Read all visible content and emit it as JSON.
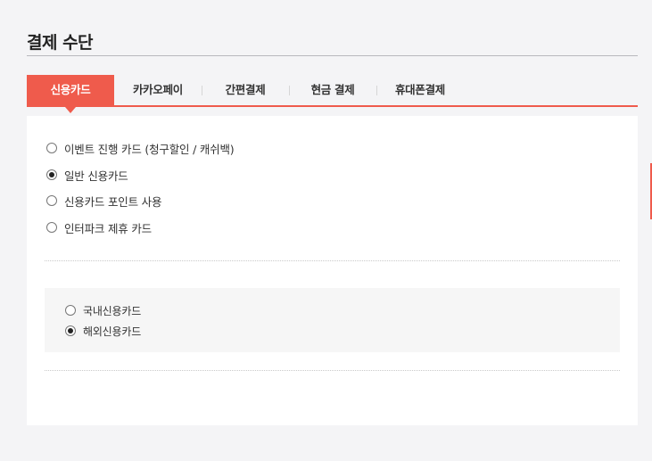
{
  "page": {
    "title": "결제 수단"
  },
  "tabs": [
    {
      "label": "신용카드",
      "active": true
    },
    {
      "label": "카카오페이",
      "active": false
    },
    {
      "label": "간편결제",
      "active": false
    },
    {
      "label": "현금 결제",
      "active": false
    },
    {
      "label": "휴대폰결제",
      "active": false
    }
  ],
  "card_options": [
    {
      "label": "이벤트 진행 카드 (청구할인 / 캐쉬백)",
      "checked": false
    },
    {
      "label": "일반 신용카드",
      "checked": true
    },
    {
      "label": "신용카드 포인트 사용",
      "checked": false
    },
    {
      "label": "인터파크 제휴 카드",
      "checked": false
    }
  ],
  "card_region_options": [
    {
      "label": "국내신용카드",
      "checked": false
    },
    {
      "label": "해외신용카드",
      "checked": true
    }
  ],
  "colors": {
    "accent": "#ef5b4c",
    "background": "#f4f4f6",
    "panel": "#ffffff",
    "sub_box": "#f6f6f6"
  }
}
